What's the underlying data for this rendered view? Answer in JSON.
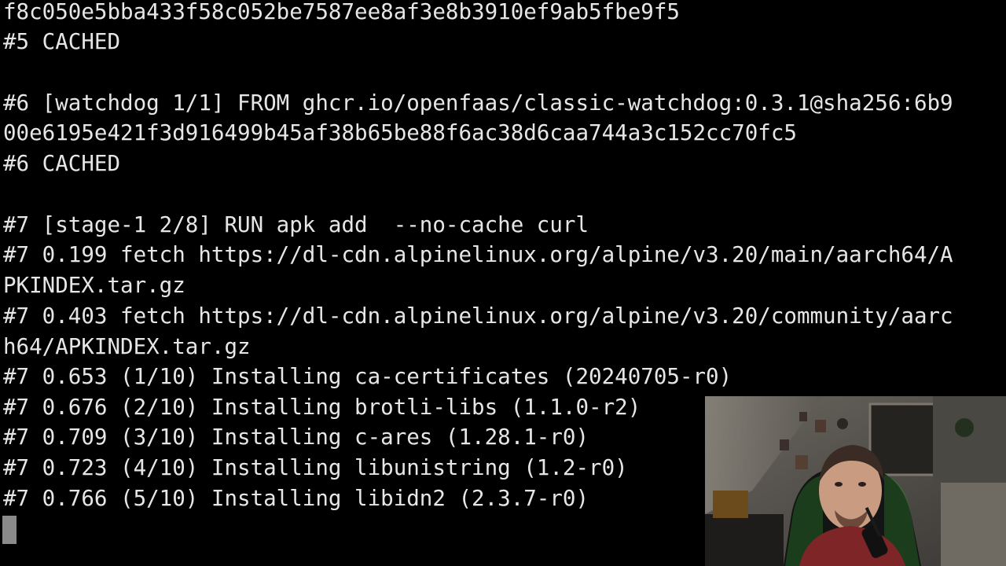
{
  "terminal": {
    "lines": [
      "f8c050e5bba433f58c052be7587ee8af3e8b3910ef9ab5fbe9f5",
      "#5 CACHED",
      "",
      "#6 [watchdog 1/1] FROM ghcr.io/openfaas/classic-watchdog:0.3.1@sha256:6b9",
      "00e6195e421f3d916499b45af38b65be88f6ac38d6caa744a3c152cc70fc5",
      "#6 CACHED",
      "",
      "#7 [stage-1 2/8] RUN apk add  --no-cache curl",
      "#7 0.199 fetch https://dl-cdn.alpinelinux.org/alpine/v3.20/main/aarch64/A",
      "PKINDEX.tar.gz",
      "#7 0.403 fetch https://dl-cdn.alpinelinux.org/alpine/v3.20/community/aarc",
      "h64/APKINDEX.tar.gz",
      "#7 0.653 (1/10) Installing ca-certificates (20240705-r0)",
      "#7 0.676 (2/10) Installing brotli-libs (1.1.0-r2)",
      "#7 0.709 (3/10) Installing c-ares (1.28.1-r0)",
      "#7 0.723 (4/10) Installing libunistring (1.2-r0)",
      "#7 0.766 (5/10) Installing libidn2 (2.3.7-r0)"
    ]
  },
  "colors": {
    "background": "#000000",
    "text": "#e6e6e6",
    "cursor": "#8a8a8a"
  }
}
